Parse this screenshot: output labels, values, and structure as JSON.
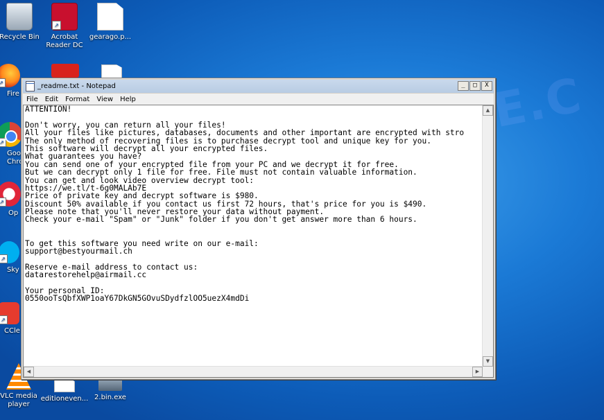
{
  "desktop": {
    "icons": [
      {
        "label": "Recycle Bin"
      },
      {
        "label": "Acrobat Reader DC"
      },
      {
        "label": "gearago.p..."
      },
      {
        "label": "Fire"
      },
      {
        "label": "Goo Chro"
      },
      {
        "label": "Op"
      },
      {
        "label": "Sky"
      },
      {
        "label": "CCle"
      },
      {
        "label": "VLC media player"
      },
      {
        "label": "editioneven..."
      },
      {
        "label": "2.bin.exe"
      }
    ],
    "watermark": "ANTISPYWARE.C"
  },
  "window": {
    "title": "_readme.txt - Notepad",
    "buttons": {
      "minimize": "_",
      "maximize": "□",
      "close": "X"
    },
    "menu": [
      "File",
      "Edit",
      "Format",
      "View",
      "Help"
    ],
    "lines": [
      "ATTENTION!",
      "",
      "Don't worry, you can return all your files!",
      "All your files like pictures, databases, documents and other important are encrypted with stro",
      "The only method of recovering files is to purchase decrypt tool and unique key for you.",
      "This software will decrypt all your encrypted files.",
      "What guarantees you have?",
      "You can send one of your encrypted file from your PC and we decrypt it for free.",
      "But we can decrypt only 1 file for free. File must not contain valuable information.",
      "You can get and look video overview decrypt tool:",
      "https://we.tl/t-6g0MALAb7E",
      "Price of private key and decrypt software is $980.",
      "Discount 50% available if you contact us first 72 hours, that's price for you is $490.",
      "Please note that you'll never restore your data without payment.",
      "Check your e-mail \"Spam\" or \"Junk\" folder if you don't get answer more than 6 hours.",
      "",
      "",
      "To get this software you need write on our e-mail:",
      "support@bestyourmail.ch",
      "",
      "Reserve e-mail address to contact us:",
      "datarestorehelp@airmail.cc",
      "",
      "Your personal ID:",
      "0550ooTsQbfXWP1oaY67DkGN5GOvuSDydfzlOO5uezX4mdDi"
    ]
  }
}
